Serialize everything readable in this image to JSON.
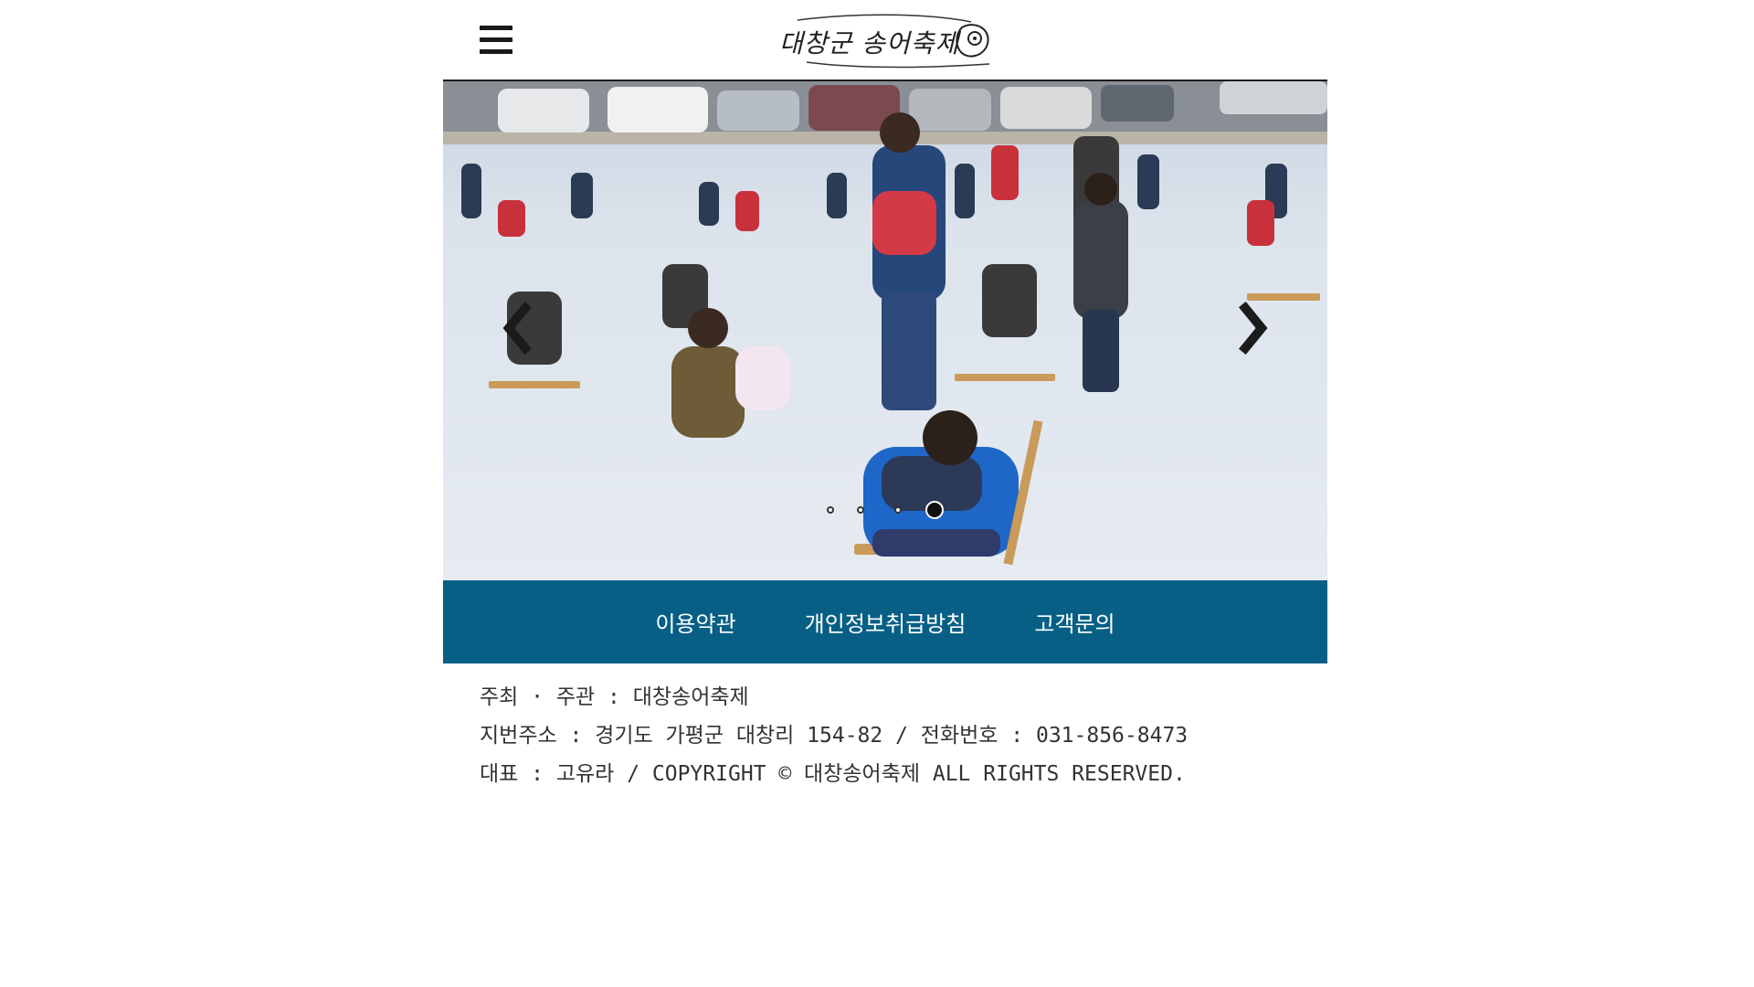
{
  "header": {
    "menu_icon": "hamburger-menu-icon",
    "logo_text": "대창군 송어축제"
  },
  "slider": {
    "prev_icon": "chevron-left-icon",
    "next_icon": "chevron-right-icon",
    "slide_count": 4,
    "active_index": 3
  },
  "footer_nav": {
    "items": [
      {
        "label": "이용약관"
      },
      {
        "label": "개인정보취급방침"
      },
      {
        "label": "고객문의"
      }
    ]
  },
  "footer_info": {
    "line1": "주최 · 주관 : 대창송어축제",
    "line2": "지번주소 : 경기도 가평군 대창리 154-82  / 전화번호 : 031-856-8473",
    "line3": "대표 : 고유라 / COPYRIGHT © 대창송어축제 ALL RIGHTS RESERVED."
  },
  "colors": {
    "footer_nav_bg": "#075f86",
    "header_border": "#1d1d1d"
  }
}
